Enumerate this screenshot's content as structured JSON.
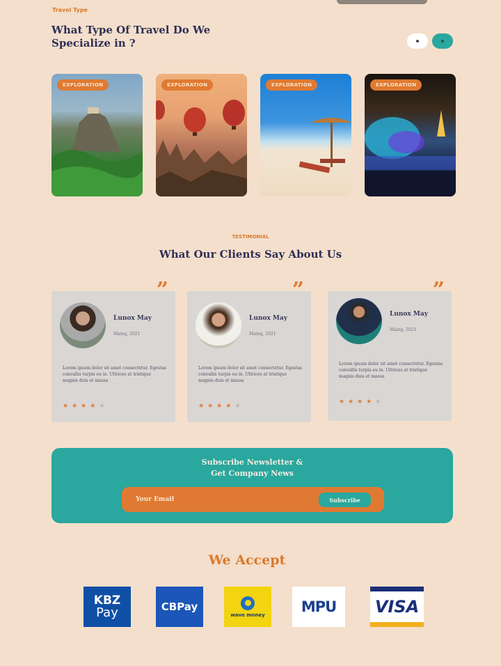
{
  "travel": {
    "eyebrow": "Travel Type",
    "title": "What Type Of Travel Do We Specialize in ?",
    "cards": [
      {
        "badge": "EXPLORATION"
      },
      {
        "badge": "EXPLORATION"
      },
      {
        "badge": "EXPLORATION"
      },
      {
        "badge": "EXPLORATION"
      }
    ]
  },
  "testimonials": {
    "eyebrow": "TESTIMONIAL",
    "title": "What Our Clients Say About Us",
    "items": [
      {
        "name": "Lunox May",
        "role": "Maing, 2021",
        "text": "Lorem ipsum dolor sit amet consectetur. Egestas convallis turpis eu in. Ultrices at tristique magnis duis et massa",
        "rating": 4
      },
      {
        "name": "Lunox May",
        "role": "Maing, 2021",
        "text": "Lorem ipsum dolor sit amet consectetur. Egestas convallis turpis eu in. Ultrices at tristique magnis duis et massa",
        "rating": 4
      },
      {
        "name": "Lunox May",
        "role": "Maing, 2021",
        "text": "Lorem ipsum dolor sit amet consectetur. Egestas convallis turpis eu in. Ultrices at tristique magnis duis et massa",
        "rating": 4
      }
    ],
    "rating_max": 5
  },
  "newsletter": {
    "title_line1": "Subscribe Newsletter &",
    "title_line2": "Get Company News",
    "placeholder": "Your Email",
    "button": "Subscribe"
  },
  "payments": {
    "title": "We Accept",
    "kbz_line1": "KBZ",
    "kbz_line2": "Pay",
    "cbpay": "CBPay",
    "wave": "wave money",
    "mpu": "MPU",
    "visa": "VISA"
  },
  "colors": {
    "background": "#f4dfcc",
    "accent_orange": "#e07a32",
    "accent_teal": "#2aa79e",
    "heading_navy": "#2f3056"
  },
  "icons": [
    "quote-icon",
    "star-icon",
    "slider-dot-icon"
  ]
}
